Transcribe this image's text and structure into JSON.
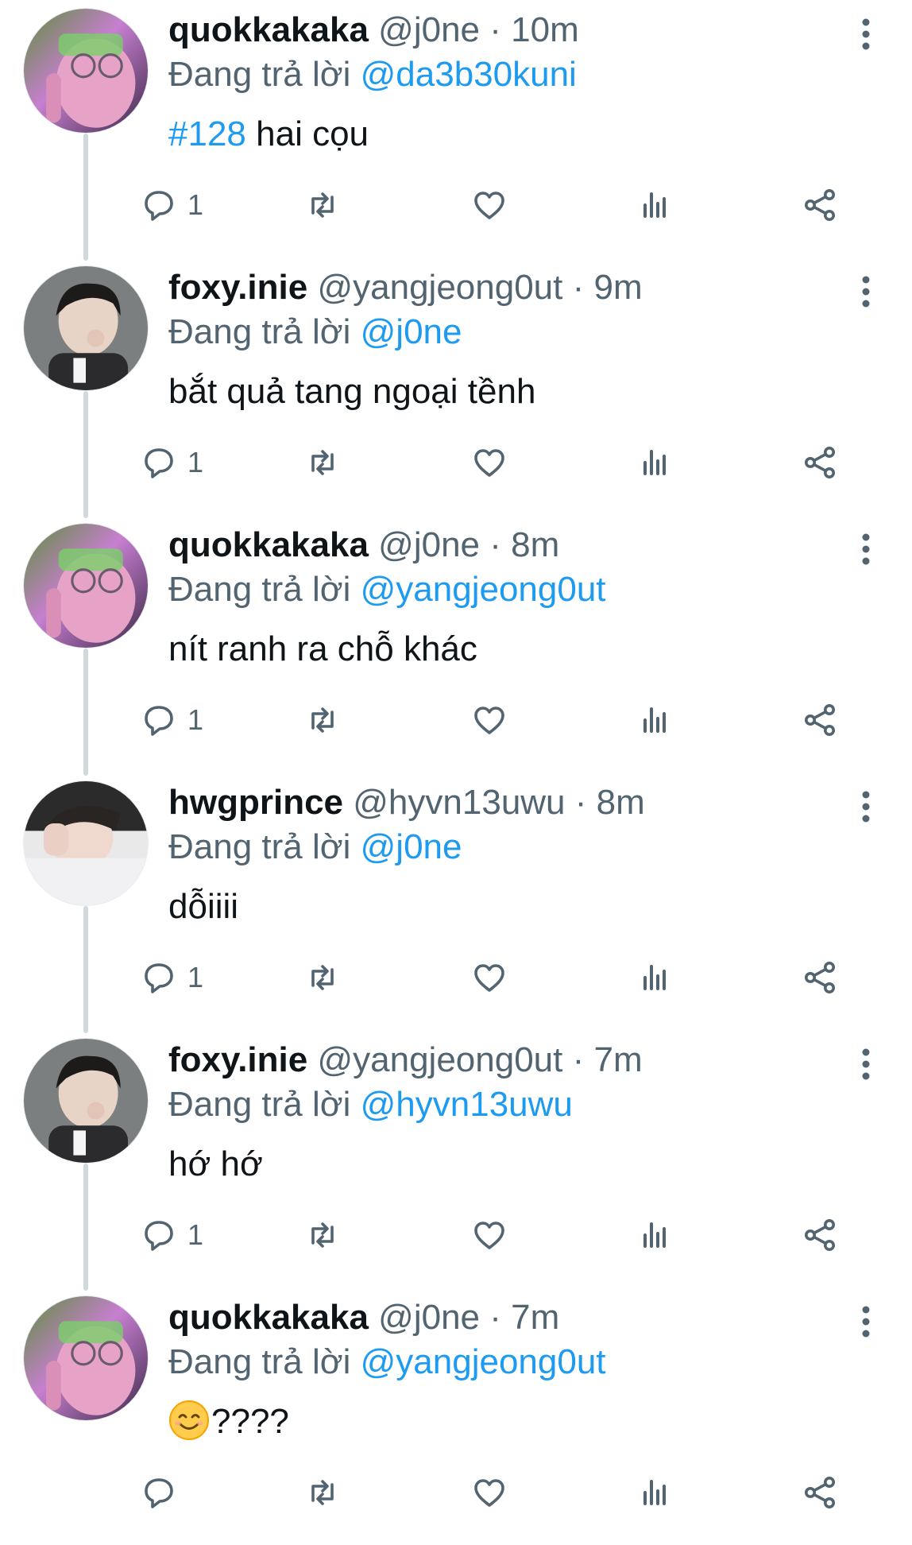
{
  "tweets": [
    {
      "name": "quokkakaka",
      "handle": "@j0ne",
      "sep": "·",
      "time": "10m",
      "reply_prefix": "Đang trả lời",
      "reply_to": "@da3b30kuni",
      "hashtag": "#128",
      "text": "hai cọu",
      "reply_count": "1"
    },
    {
      "name": "foxy.inie",
      "handle": "@yangjeong0ut",
      "sep": "·",
      "time": "9m",
      "reply_prefix": "Đang trả lời",
      "reply_to": "@j0ne",
      "hashtag": "",
      "text": "bắt quả tang ngoại tềnh",
      "reply_count": "1"
    },
    {
      "name": "quokkakaka",
      "handle": "@j0ne",
      "sep": "·",
      "time": "8m",
      "reply_prefix": "Đang trả lời",
      "reply_to": "@yangjeong0ut",
      "hashtag": "",
      "text": "nít ranh ra chỗ khác",
      "reply_count": "1"
    },
    {
      "name": "hwgprince",
      "handle": "@hyvn13uwu",
      "sep": "·",
      "time": "8m",
      "reply_prefix": "Đang trả lời",
      "reply_to": "@j0ne",
      "hashtag": "",
      "text": "dỗiiii",
      "reply_count": "1"
    },
    {
      "name": "foxy.inie",
      "handle": "@yangjeong0ut",
      "sep": "·",
      "time": "7m",
      "reply_prefix": "Đang trả lời",
      "reply_to": "@hyvn13uwu",
      "hashtag": "",
      "text": "hớ hớ",
      "reply_count": "1"
    },
    {
      "name": "quokkakaka",
      "handle": "@j0ne",
      "sep": "·",
      "time": "7m",
      "reply_prefix": "Đang trả lời",
      "reply_to": "@yangjeong0ut",
      "hashtag": "",
      "text": "????",
      "reply_count": ""
    }
  ],
  "colors": {
    "link": "#1d9bf0",
    "muted": "#536471",
    "text": "#0f1419",
    "thread_line": "#cfd9de"
  },
  "icons": [
    "reply-icon",
    "retweet-icon",
    "like-icon",
    "views-icon",
    "share-icon",
    "more-icon",
    "smiling-face-emoji"
  ]
}
